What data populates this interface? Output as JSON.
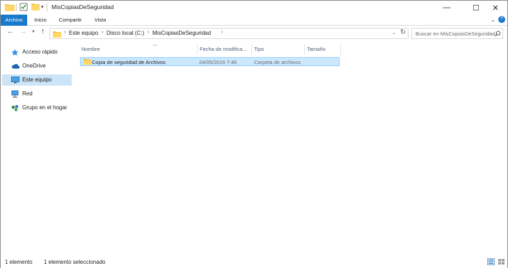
{
  "window": {
    "title": "MisCopiasDeSeguridad",
    "controls": {
      "minimize": "—",
      "maximize": "☐",
      "close": "✕"
    }
  },
  "ribbon": {
    "tabs": [
      {
        "label": "Archivo",
        "active": true
      },
      {
        "label": "Inicio"
      },
      {
        "label": "Compartir"
      },
      {
        "label": "Vista"
      }
    ],
    "expand_glyph": "⌄",
    "help_glyph": "?"
  },
  "address": {
    "breadcrumbs": [
      "Este equipo",
      "Disco local (C:)",
      "MisCopiasDeSeguridad"
    ],
    "separator": "›",
    "search_placeholder": "Buscar en MisCopiasDeSeguridad"
  },
  "sidebar": {
    "items": [
      {
        "label": "Acceso rápido",
        "icon": "star-icon"
      },
      {
        "label": "OneDrive",
        "icon": "cloud-icon"
      },
      {
        "label": "Este equipo",
        "icon": "computer-icon",
        "selected": true
      },
      {
        "label": "Red",
        "icon": "network-icon"
      },
      {
        "label": "Grupo en el hogar",
        "icon": "homegroup-icon"
      }
    ]
  },
  "columns": [
    "Nombre",
    "Fecha de modifica...",
    "Tipo",
    "Tamaño"
  ],
  "files": [
    {
      "name": "Copia de seguridad de Archivos",
      "date": "24/05/2016 7:48",
      "type": "Carpeta de archivos",
      "size": ""
    }
  ],
  "status": {
    "count": "1 elemento",
    "selection": "1 elemento seleccionado"
  },
  "colors": {
    "accent": "#1979ca",
    "selection": "#cce8ff",
    "folder": "#f3c64b"
  }
}
